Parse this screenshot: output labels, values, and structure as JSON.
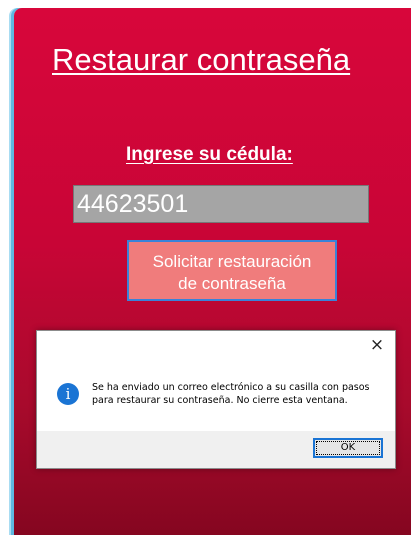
{
  "form": {
    "title": "Restaurar contraseña",
    "id_label": "Ingrese su cédula:",
    "id_value": "44623501",
    "request_button_line1": "Solicitar restauración",
    "request_button_line2": "de contraseña"
  },
  "dialog": {
    "close_glyph": "×",
    "icon": "info-icon",
    "icon_glyph": "i",
    "message_line1": "Se ha enviado un correo electrónico a su casilla con pasos",
    "message_line2": "para restaurar su contraseña. No cierre esta ventana.",
    "ok_label": "OK"
  },
  "colors": {
    "window_top": "#d8063b",
    "window_bottom": "#850620",
    "input_bg": "#a5a5a5",
    "button_bg": "#f07c7c",
    "button_border": "#3a82d8",
    "info_icon": "#1a74d4"
  }
}
